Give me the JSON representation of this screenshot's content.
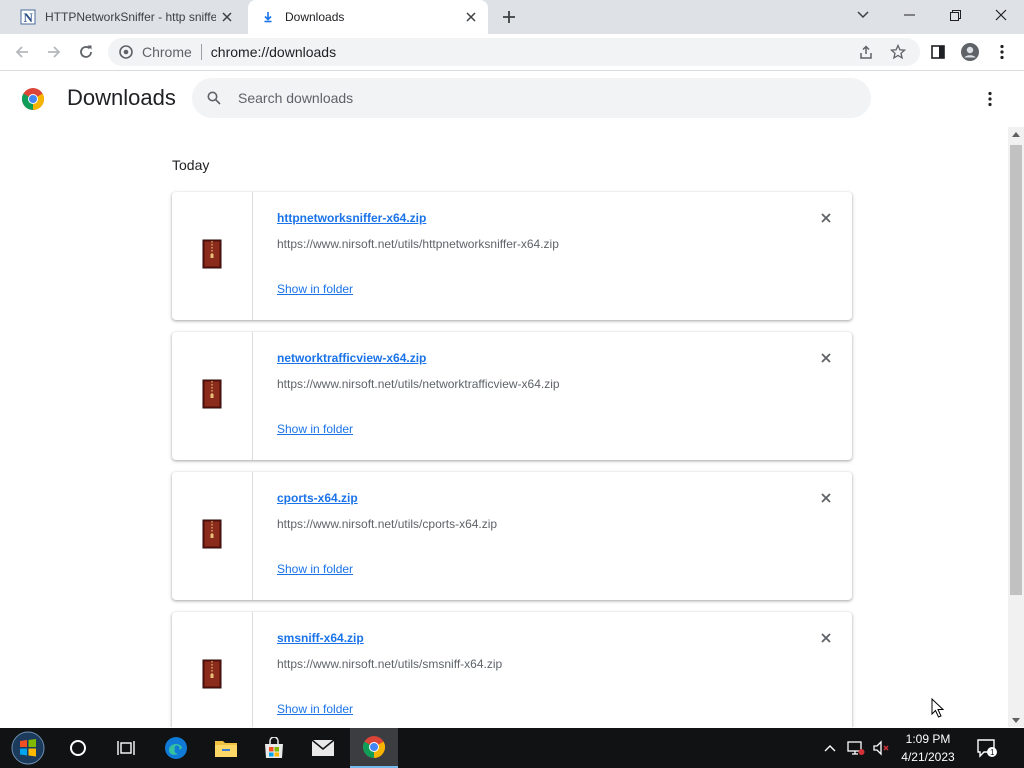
{
  "tabs": [
    {
      "title": "HTTPNetworkSniffer - http sniffer",
      "active": false
    },
    {
      "title": "Downloads",
      "active": true
    }
  ],
  "omnibox": {
    "site_label": "Chrome",
    "url": "chrome://downloads"
  },
  "downloads_page": {
    "title": "Downloads",
    "search_placeholder": "Search downloads",
    "date_group": "Today",
    "items": [
      {
        "filename": "httpnetworksniffer-x64.zip",
        "url": "https://www.nirsoft.net/utils/httpnetworksniffer-x64.zip",
        "action": "Show in folder"
      },
      {
        "filename": "networktrafficview-x64.zip",
        "url": "https://www.nirsoft.net/utils/networktrafficview-x64.zip",
        "action": "Show in folder"
      },
      {
        "filename": "cports-x64.zip",
        "url": "https://www.nirsoft.net/utils/cports-x64.zip",
        "action": "Show in folder"
      },
      {
        "filename": "smsniff-x64.zip",
        "url": "https://www.nirsoft.net/utils/smsniff-x64.zip",
        "action": "Show in folder"
      }
    ]
  },
  "taskbar": {
    "apps": [
      "start-icon",
      "cortana-icon",
      "task-view-icon",
      "edge-icon",
      "file-explorer-icon",
      "store-icon",
      "mail-icon",
      "chrome-icon"
    ],
    "clock_time": "1:09 PM",
    "clock_date": "4/21/2023",
    "notification_count": "1"
  },
  "colors": {
    "accent": "#1a73e8",
    "tabstrip": "#dee1e6",
    "taskbar": "#101214"
  }
}
